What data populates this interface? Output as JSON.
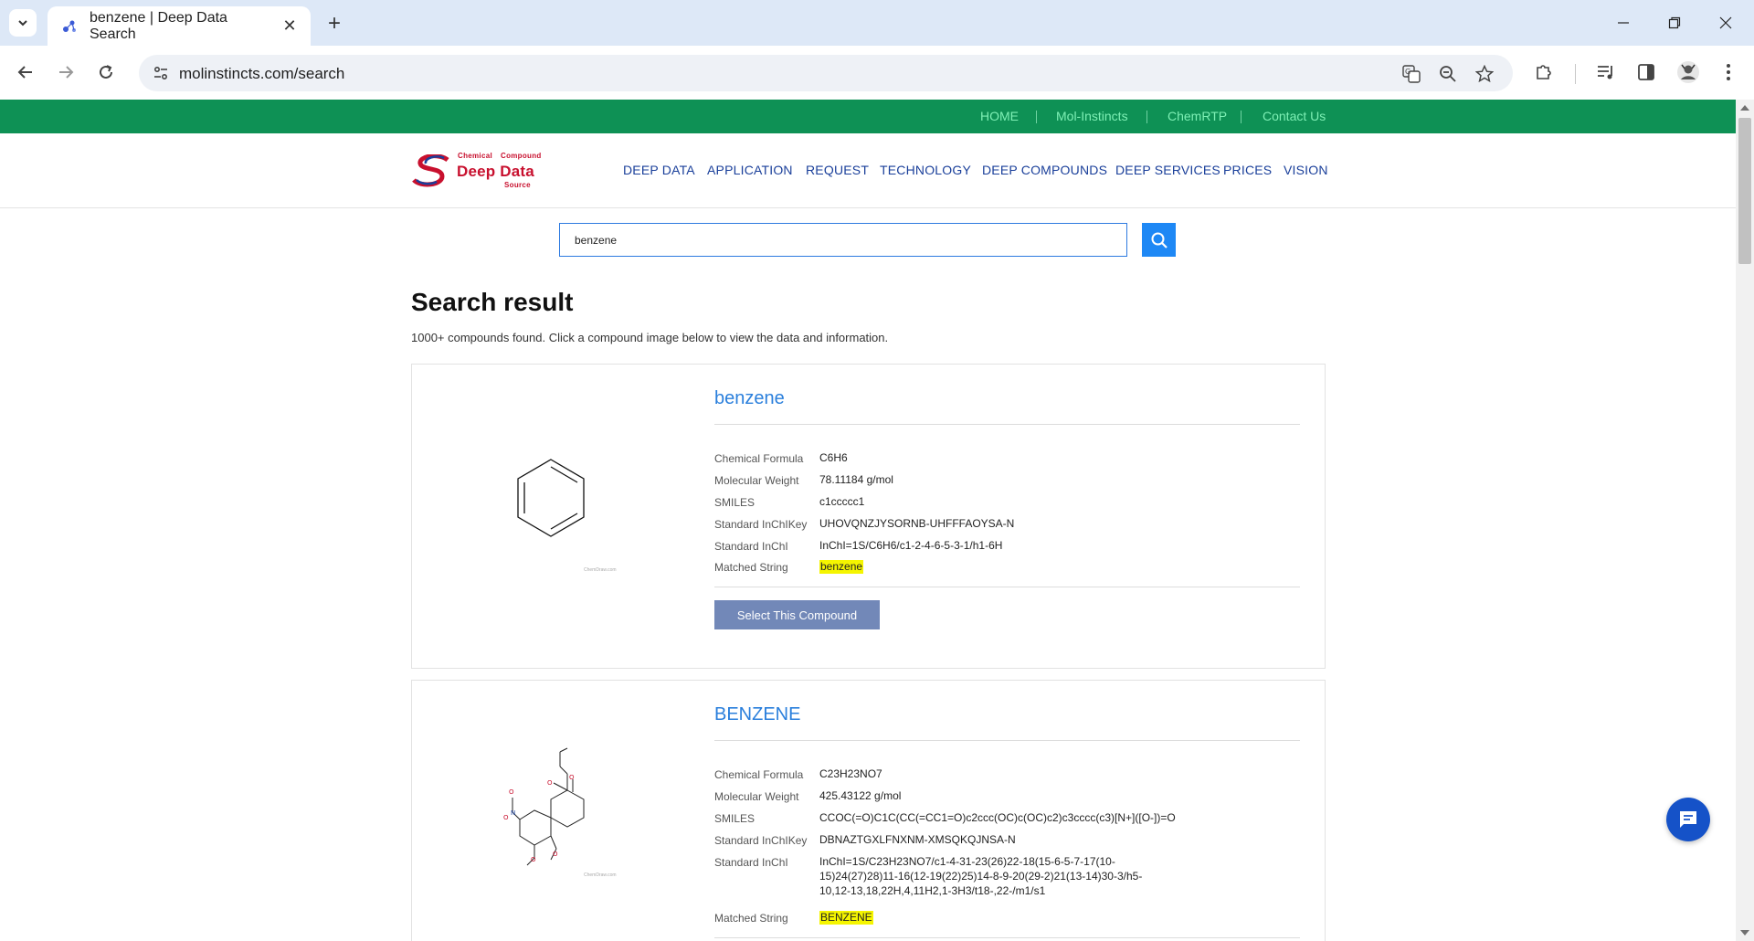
{
  "browser": {
    "tab_title": "benzene | Deep Data Search",
    "url": "molinstincts.com/search"
  },
  "topbar": {
    "links": [
      "HOME",
      "Mol-Instincts",
      "ChemRTP",
      "Contact Us"
    ]
  },
  "logo": {
    "line1a": "Chemical",
    "line1b": "Compound",
    "line2": "Deep Data",
    "line3": "Source"
  },
  "nav": {
    "items": [
      "DEEP DATA",
      "APPLICATION",
      "REQUEST",
      "TECHNOLOGY",
      "DEEP COMPOUNDS",
      "DEEP SERVICES",
      "PRICES",
      "VISION"
    ]
  },
  "search": {
    "value": "benzene"
  },
  "results": {
    "title": "Search result",
    "count_text": "1000+ compounds found. Click a compound image below to view the data and information.",
    "labels": {
      "formula": "Chemical Formula",
      "weight": "Molecular Weight",
      "smiles": "SMILES",
      "inchikey": "Standard InChIKey",
      "inchi": "Standard InChI",
      "matched": "Matched String"
    },
    "select_label": "Select This Compound",
    "watermark": "ChemDraw.com",
    "items": [
      {
        "name": "benzene",
        "formula": "C6H6",
        "weight": "78.11184 g/mol",
        "smiles": "c1ccccc1",
        "inchikey": "UHOVQNZJYSORNB-UHFFFAOYSA-N",
        "inchi": "InChI=1S/C6H6/c1-2-4-6-5-3-1/h1-6H",
        "matched": "benzene"
      },
      {
        "name": "BENZENE",
        "formula": "C23H23NO7",
        "weight": "425.43122 g/mol",
        "smiles": "CCOC(=O)C1C(CC(=CC1=O)c2ccc(OC)c(OC)c2)c3cccc(c3)[N+]([O-])=O",
        "inchikey": "DBNAZTGXLFNXNM-XMSQKQJNSA-N",
        "inchi_line1": "InChI=1S/C23H23NO7/c1-4-31-23(26)22-18(15-6-5-7-17(10-",
        "inchi_line2": "15)24(27)28)11-16(12-19(22)25)14-8-9-20(29-2)21(13-14)30-3/h5-",
        "inchi_line3": "10,12-13,18,22H,4,11H2,1-3H3/t18-,22-/m1/s1",
        "matched": "BENZENE"
      }
    ]
  },
  "colors": {
    "topbar_green": "#0e9155",
    "nav_blue": "#1a3f9a",
    "link_blue": "#2a7fdc",
    "highlight": "#f5f500",
    "button": "#7288b8",
    "logo_red": "#c8102e"
  },
  "icons": {
    "chrome": [
      "chevron-down-icon",
      "close-icon",
      "plus-icon",
      "minimize-icon",
      "restore-icon",
      "back-icon",
      "forward-icon",
      "reload-icon",
      "site-settings-icon",
      "translate-icon",
      "zoom-icon",
      "star-icon",
      "extensions-icon",
      "media-icon",
      "sidepanel-icon",
      "profile-icon",
      "menu-icon"
    ],
    "page": [
      "search-icon",
      "chat-icon"
    ]
  }
}
